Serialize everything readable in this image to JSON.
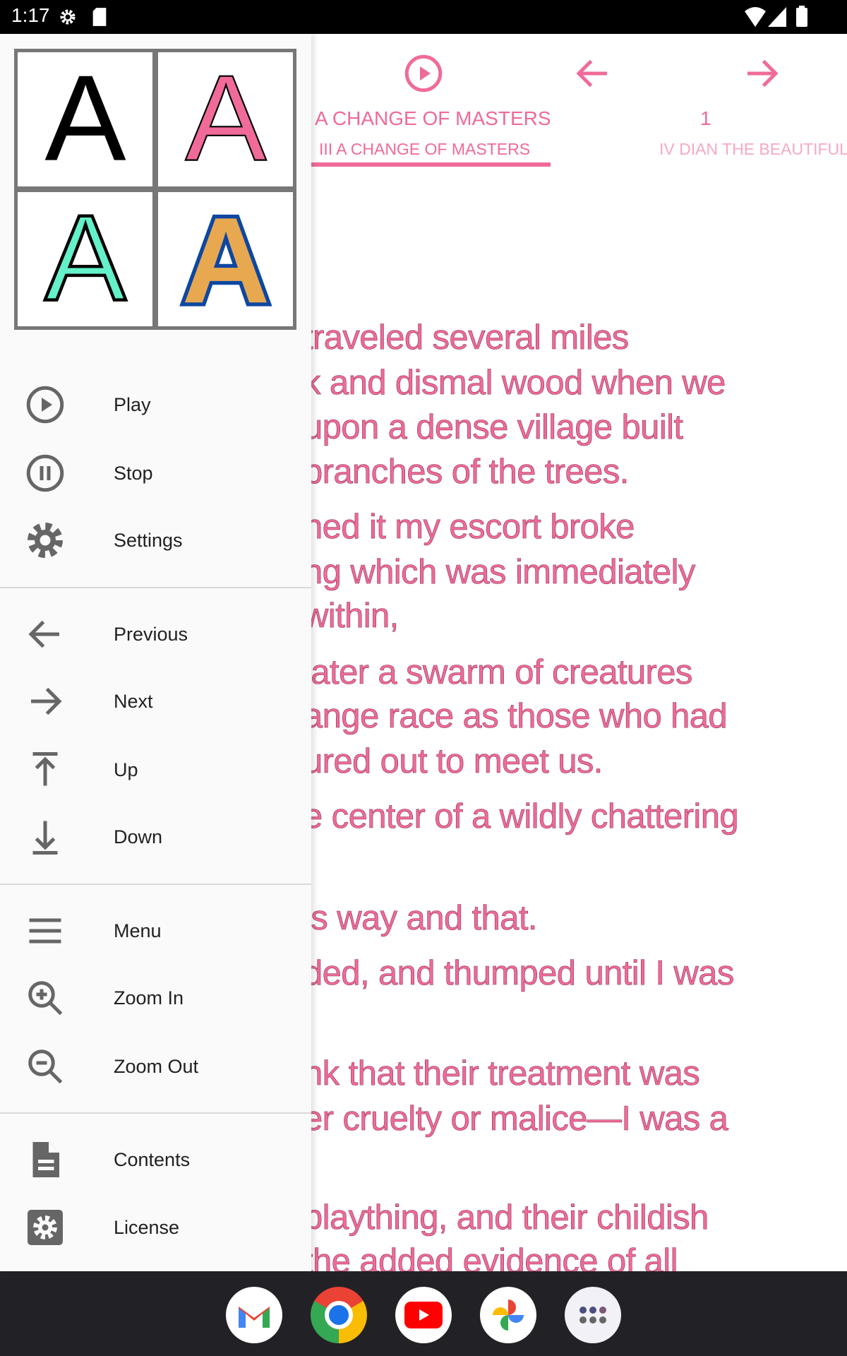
{
  "status_bar": {
    "time": "1:17",
    "icons": [
      "settings-icon",
      "sd-card-icon",
      "wifi-icon",
      "signal-icon",
      "battery-icon"
    ]
  },
  "toolbar": {
    "icons": [
      "play-circle-icon",
      "arrow-back-icon",
      "arrow-forward-icon"
    ]
  },
  "tabs": {
    "current_title": "I A CHANGE OF MASTERS",
    "page": "1",
    "items": [
      {
        "label": "III A CHANGE OF MASTERS",
        "selected": true
      },
      {
        "label": "IV DIAN THE BEAUTIFUL",
        "selected": false
      }
    ]
  },
  "text_lines": [
    "traveled several miles",
    "k and dismal wood when we",
    "upon a dense village built",
    " branches of the trees.",
    "hed it my escort broke",
    "ng which was immediately",
    "within,",
    "later a swarm of creatures",
    "ange race as those who had",
    "ured out to meet us.",
    "e center of a wildly chattering",
    "is way and that.",
    "ded, and thumped until I was",
    "nk that their treatment was",
    "er cruelty or malice—I was a",
    "plaything, and their childish",
    "the added evidence of all"
  ],
  "font_styles": [
    {
      "letter": "A",
      "fill": "#000000",
      "stroke": "none"
    },
    {
      "letter": "A",
      "fill": "#f06a9a",
      "stroke": "#000000"
    },
    {
      "letter": "A",
      "fill": "#64f0c8",
      "stroke": "#000000"
    },
    {
      "letter": "A",
      "fill": "#e8a850",
      "stroke": "#0d47a1"
    }
  ],
  "menu": {
    "groups": [
      [
        {
          "label": "Play",
          "icon": "play-circle-icon"
        },
        {
          "label": "Stop",
          "icon": "pause-circle-icon"
        },
        {
          "label": "Settings",
          "icon": "gear-icon"
        }
      ],
      [
        {
          "label": "Previous",
          "icon": "arrow-back-icon"
        },
        {
          "label": "Next",
          "icon": "arrow-forward-icon"
        },
        {
          "label": "Up",
          "icon": "upload-icon"
        },
        {
          "label": "Down",
          "icon": "download-icon"
        }
      ],
      [
        {
          "label": "Menu",
          "icon": "hamburger-icon"
        },
        {
          "label": "Zoom In",
          "icon": "zoom-in-icon"
        },
        {
          "label": "Zoom Out",
          "icon": "zoom-out-icon"
        }
      ],
      [
        {
          "label": "Contents",
          "icon": "document-icon"
        },
        {
          "label": "License",
          "icon": "settings-box-icon"
        }
      ]
    ]
  },
  "dock": [
    "Gmail",
    "Chrome",
    "YouTube",
    "Photos",
    "App drawer"
  ],
  "colors": {
    "accent": "#f06a9a",
    "accent_light": "#f7a8c4",
    "icon_gray": "#666666",
    "nav_bg": "#222226"
  }
}
